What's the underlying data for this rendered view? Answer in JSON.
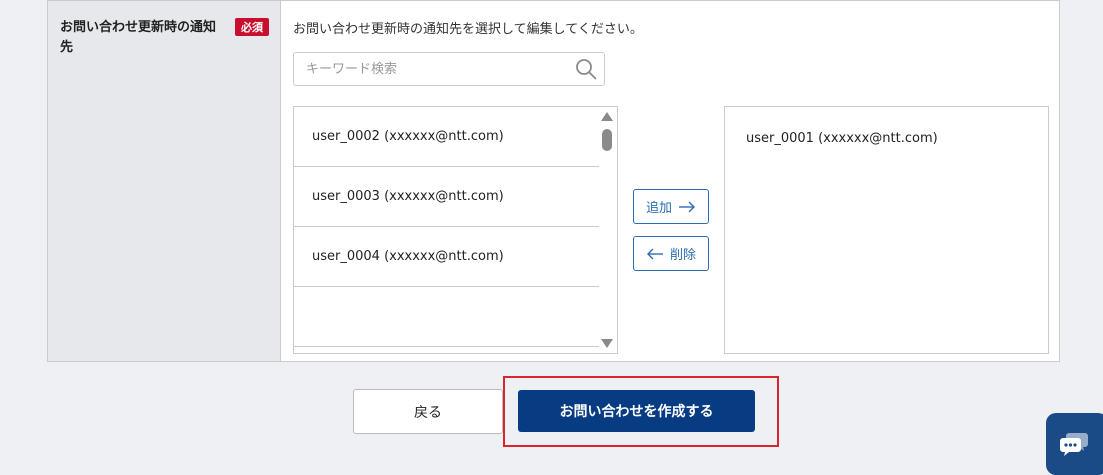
{
  "field": {
    "label": "お問い合わせ更新時の通知先",
    "required_badge": "必須",
    "instruction": "お問い合わせ更新時の通知先を選択して編集してください。"
  },
  "search": {
    "placeholder": "キーワード検索",
    "value": ""
  },
  "available_list": {
    "items": [
      {
        "label": "user_0002 (xxxxxx@ntt.com)"
      },
      {
        "label": "user_0003 (xxxxxx@ntt.com)"
      },
      {
        "label": "user_0004 (xxxxxx@ntt.com)"
      }
    ]
  },
  "buttons": {
    "add_label": "追加",
    "remove_label": "削除",
    "back_label": "戻る",
    "create_label": "お問い合わせを作成する"
  },
  "selected_list": {
    "items": [
      {
        "label": "user_0001 (xxxxxx@ntt.com)"
      }
    ]
  },
  "icons": {
    "search": "search-icon",
    "add_arrow": "arrow-right-icon",
    "remove_arrow": "arrow-left-icon",
    "chat": "chat-bubbles-icon"
  },
  "colors": {
    "primary": "#073b82",
    "accent": "#2a6db3",
    "required": "#c8102e",
    "highlight": "#d9262c",
    "chat_widget": "#1b4b87"
  }
}
